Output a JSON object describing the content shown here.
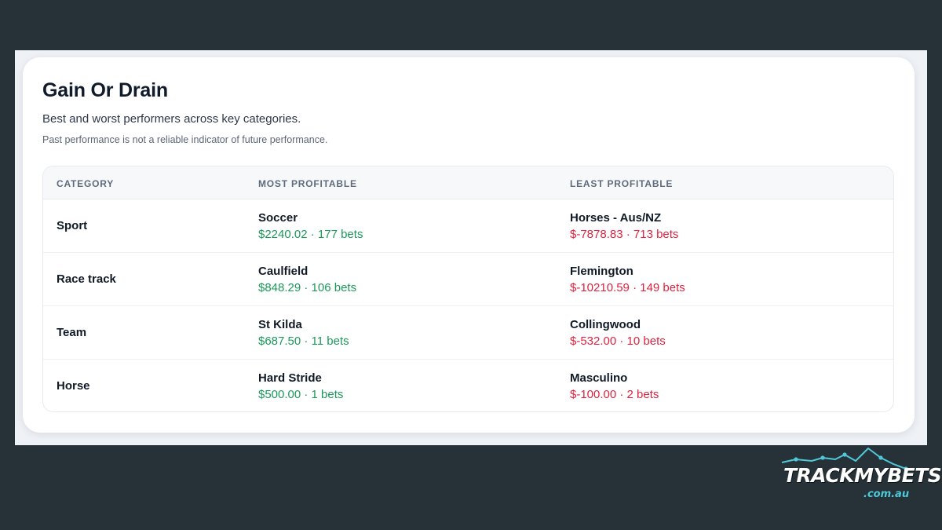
{
  "card": {
    "title": "Gain Or Drain",
    "subtitle": "Best and worst performers across key categories.",
    "disclaimer": "Past performance is not a reliable indicator of future performance."
  },
  "table": {
    "headers": {
      "category": "CATEGORY",
      "most": "MOST PROFITABLE",
      "least": "LEAST PROFITABLE"
    },
    "rows": [
      {
        "category": "Sport",
        "most_name": "Soccer",
        "most_stat": "$2240.02 · 177 bets",
        "least_name": "Horses - Aus/NZ",
        "least_stat": "$-7878.83 · 713 bets"
      },
      {
        "category": "Race track",
        "most_name": "Caulfield",
        "most_stat": "$848.29 · 106 bets",
        "least_name": "Flemington",
        "least_stat": "$-10210.59 · 149 bets"
      },
      {
        "category": "Team",
        "most_name": "St Kilda",
        "most_stat": "$687.50 · 11 bets",
        "least_name": "Collingwood",
        "least_stat": "$-532.00 · 10 bets"
      },
      {
        "category": "Horse",
        "most_name": "Hard Stride",
        "most_stat": "$500.00 · 1 bets",
        "least_name": "Masculino",
        "least_stat": "$-100.00 · 2 bets"
      }
    ]
  },
  "branding": {
    "logo_text": "TRACKMYBETS",
    "logo_domain": ".com.au"
  },
  "colors": {
    "background": "#273238",
    "gain": "#1a9a5a",
    "drain": "#e0223f",
    "logo_accent": "#4fc9d8"
  }
}
